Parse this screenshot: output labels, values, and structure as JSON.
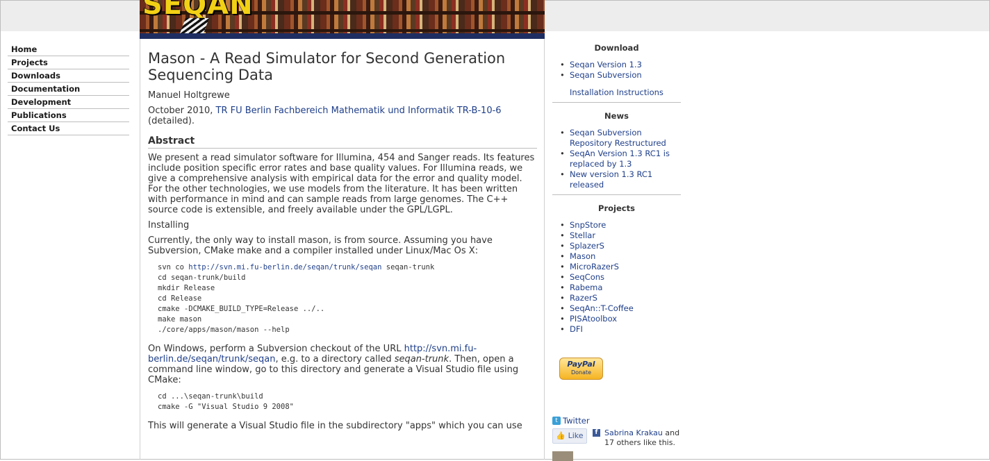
{
  "banner": {
    "logo_text": "SEQAN"
  },
  "leftnav": {
    "items": [
      "Home",
      "Projects",
      "Downloads",
      "Documentation",
      "Development",
      "Publications",
      "Contact Us"
    ]
  },
  "main": {
    "title": "Mason - A Read Simulator for Second Generation Sequencing Data",
    "author": "Manuel Holtgrewe",
    "pub_date": "October 2010, ",
    "pub_link": "TR FU Berlin Fachbereich Mathematik und Informatik TR-B-10-6",
    "pub_suffix": " (detailed).",
    "abstract_heading": "Abstract",
    "abstract_text": "We present a read simulator software for Illumina, 454 and Sanger reads. Its features include position specific error rates and base quality values. For Illumina reads, we give a comprehensive analysis with empirical data for the error and quality model. For the other technologies, we use models from the literature. It has been written with performance in mind and can sample reads from large genomes. The C++ source code is extensible, and freely available under the GPL/LGPL.",
    "installing_label": "Installing",
    "install_intro": "Currently, the only way to install mason, is from source. Assuming you have Subversion, CMake make and a compiler installed under Linux/Mac Os X:",
    "code1_prefix": "svn co ",
    "code1_link": "http://svn.mi.fu-berlin.de/seqan/trunk/seqan",
    "code1_suffix": " seqan-trunk",
    "code1_rest": "cd seqan-trunk/build\nmkdir Release\ncd Release\ncmake -DCMAKE_BUILD_TYPE=Release ../..\nmake mason\n./core/apps/mason/mason --help",
    "windows_prefix": "On Windows, perform a Subversion checkout of the URL ",
    "windows_link": "http://svn.mi.fu-berlin.de/seqan/trunk/seqan",
    "windows_mid": ", e.g. to a directory called ",
    "windows_dir": "seqan-trunk",
    "windows_suffix": ". Then, open a command line window, go to this directory and generate a Visual Studio file using CMake:",
    "code2": "cd ...\\seqan-trunk\\build\ncmake -G \"Visual Studio 9 2008\"",
    "final_text": "This will generate a Visual Studio file in the subdirectory \"apps\" which you can use"
  },
  "sidebar": {
    "download": {
      "heading": "Download",
      "items": [
        "Seqan Version 1.3",
        "Seqan Subversion"
      ],
      "install_link": "Installation Instructions"
    },
    "news": {
      "heading": "News",
      "items": [
        "Seqan Subversion Repository Restructured",
        "SeqAn Version 1.3 RC1 is replaced by 1.3",
        "New version 1.3 RC1 released"
      ]
    },
    "projects": {
      "heading": "Projects",
      "items": [
        "SnpStore",
        "Stellar",
        "SplazerS",
        "Mason",
        "MicroRazerS",
        "SeqCons",
        "Rabema",
        "RazerS",
        "SeqAn::T-Coffee",
        "PISAtoolbox",
        "DFI"
      ]
    },
    "paypal": {
      "brand": "PayPal",
      "label": "Donate"
    },
    "twitter": {
      "label": "Twitter"
    },
    "facebook": {
      "like_label": "Like",
      "person": "Sabrina Krakau",
      "rest": " and 17 others like this."
    }
  }
}
